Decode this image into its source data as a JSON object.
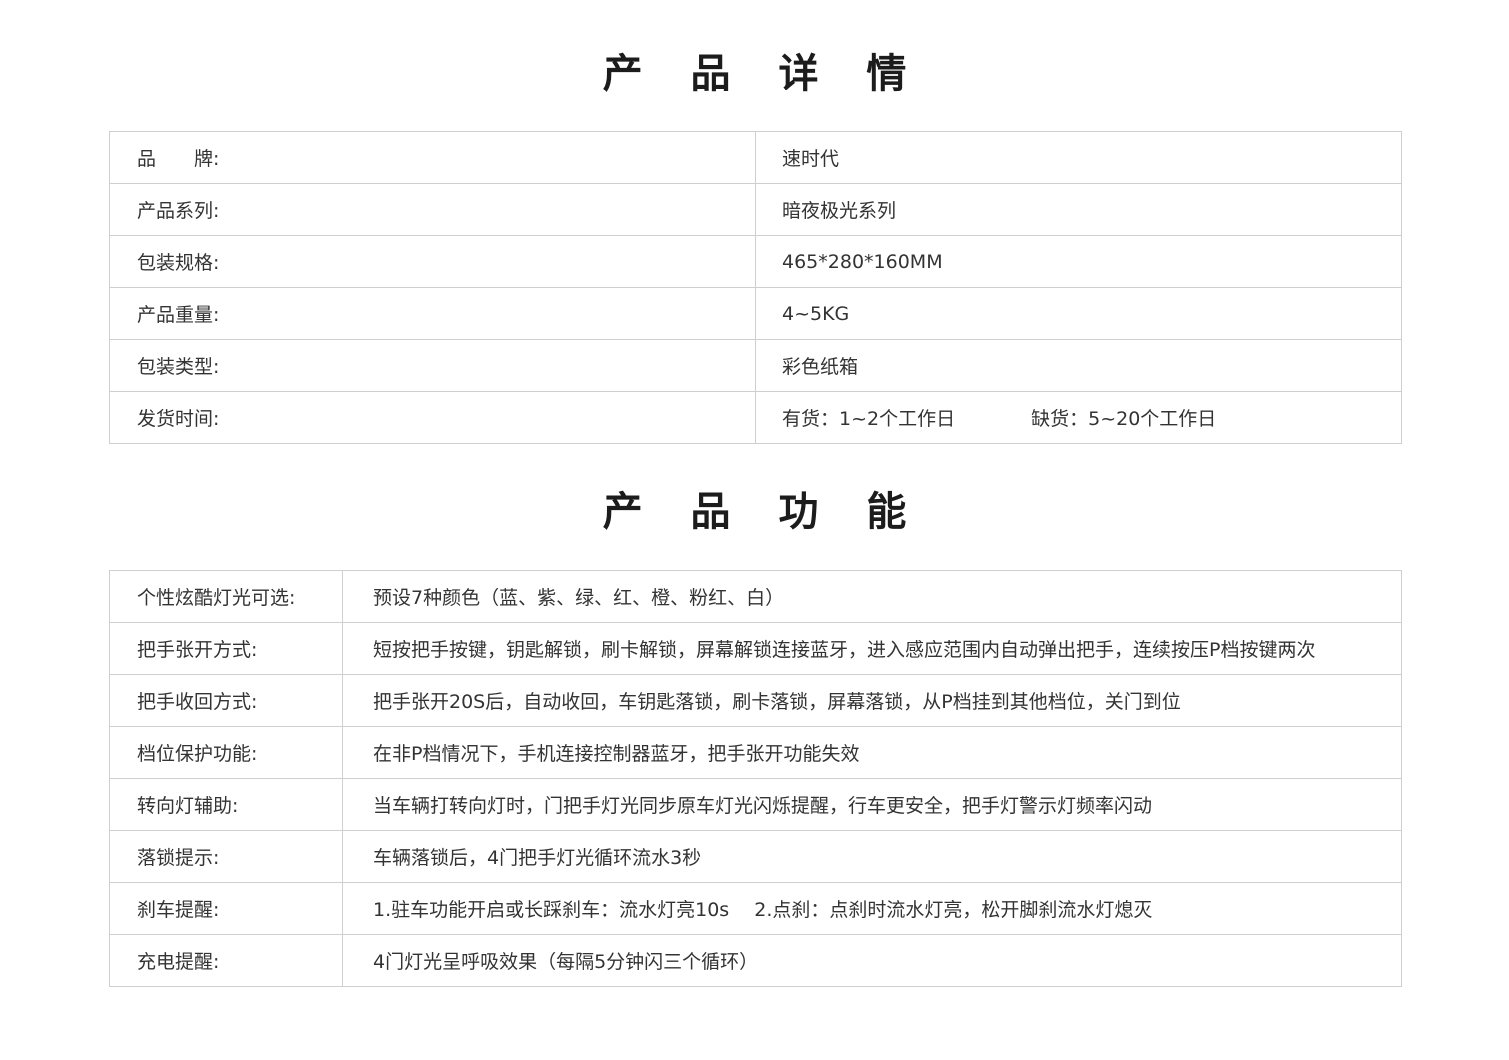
{
  "details": {
    "title": "产 品 详 情",
    "rows": [
      {
        "label": "品　　牌:",
        "value": "速时代"
      },
      {
        "label": "产品系列:",
        "value": "暗夜极光系列"
      },
      {
        "label": "包装规格:",
        "value": "465*280*160MM"
      },
      {
        "label": "产品重量:",
        "value": "4~5KG"
      },
      {
        "label": "包装类型:",
        "value": "彩色纸箱"
      },
      {
        "label": "发货时间:",
        "value_in_stock": "有货：1~2个工作日",
        "value_out_of_stock": "缺货：5~20个工作日"
      }
    ]
  },
  "features": {
    "title": "产 品 功 能",
    "rows": [
      {
        "label": "个性炫酷灯光可选:",
        "value": "预设7种颜色（蓝、紫、绿、红、橙、粉红、白）"
      },
      {
        "label": "把手张开方式:",
        "value": "短按把手按键，钥匙解锁，刷卡解锁，屏幕解锁连接蓝牙，进入感应范围内自动弹出把手，连续按压P档按键两次"
      },
      {
        "label": "把手收回方式:",
        "value": "把手张开20S后，自动收回，车钥匙落锁，刷卡落锁，屏幕落锁，从P档挂到其他档位，关门到位"
      },
      {
        "label": "档位保护功能:",
        "value": "在非P档情况下，手机连接控制器蓝牙，把手张开功能失效"
      },
      {
        "label": "转向灯辅助:",
        "value": "当车辆打转向灯时，门把手灯光同步原车灯光闪烁提醒，行车更安全，把手灯警示灯频率闪动"
      },
      {
        "label": "落锁提示:",
        "value": "车辆落锁后，4门把手灯光循环流水3秒"
      },
      {
        "label": "刹车提醒:",
        "value": "1.驻车功能开启或长踩刹车：流水灯亮10s　 2.点刹：点刹时流水灯亮，松开脚刹流水灯熄灭"
      },
      {
        "label": "充电提醒:",
        "value": "4门灯光呈呼吸效果（每隔5分钟闪三个循环）"
      }
    ]
  }
}
